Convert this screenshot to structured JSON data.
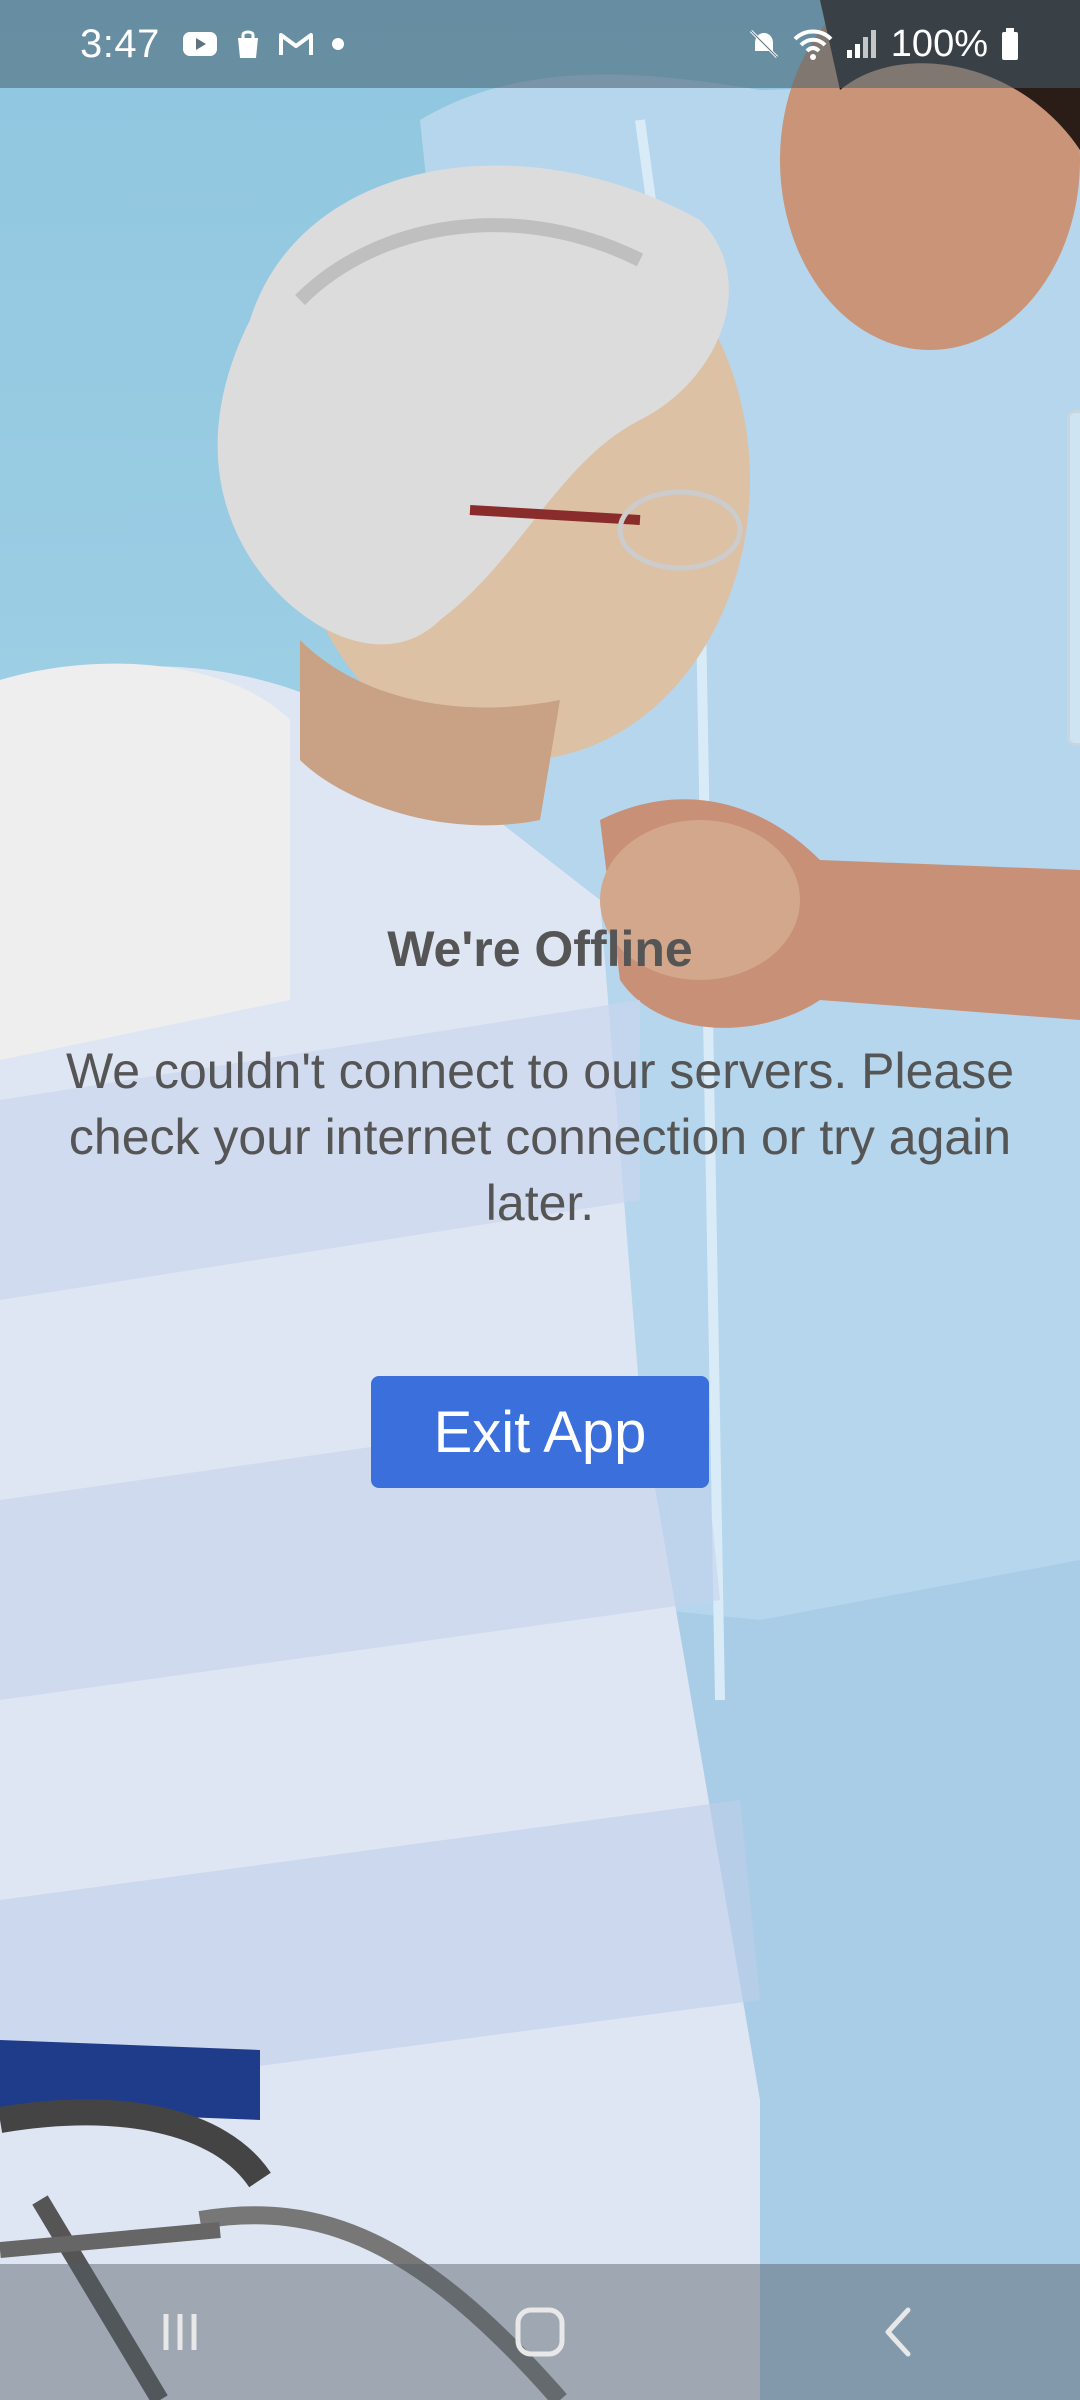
{
  "status_bar": {
    "time": "3:47",
    "battery_percent": "100%",
    "left_icons": [
      "youtube-icon",
      "shopping-bag-icon",
      "gmail-icon",
      "dot-icon"
    ],
    "right_icons": [
      "mute-icon",
      "wifi-icon",
      "signal-icon",
      "battery-icon"
    ]
  },
  "offline": {
    "title": "We're Offline",
    "message": "We couldn't connect to our servers. Please check your internet connection or try again later.",
    "exit_label": "Exit App"
  },
  "nav_bar": {
    "icons": [
      "recents-icon",
      "home-icon",
      "back-icon"
    ]
  },
  "colors": {
    "button_bg": "#3a6fdc",
    "text": "#555555",
    "background": "#8fc6df"
  }
}
